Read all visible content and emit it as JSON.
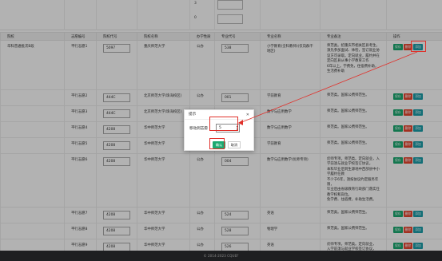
{
  "top_numbers": [
    "3",
    "0"
  ],
  "table": {
    "headers": [
      "院校",
      "志愿编号",
      "院校代号",
      "院校名称",
      "办学性质",
      "专业代号",
      "专业名称",
      "专业备注",
      "操作"
    ],
    "rows": [
      {
        "school": "华科普通批次B段",
        "vol": "平行志愿1",
        "code": "5097",
        "name": "重庆师范大学",
        "nature": "公办",
        "mcode": "538",
        "major": "小学教育(全科教师)(仅向群干地区)",
        "notes": [
          "师范类。招重庆市相关区县考生，须先参加面试、体检，签订就业协议方可录取。定向就业，履约并在定向区县从事小学教育工作",
          "6年以上。学费免，住宿费补助，生活费补助"
        ],
        "buttons": [
          "保存",
          "删除",
          "添加"
        ]
      },
      {
        "school": "",
        "vol": "平行志愿2",
        "code": "444C",
        "name": "北京师范大学(珠海校区)",
        "nature": "公办",
        "mcode": "001",
        "major": "学前教育",
        "notes": [
          "师范类。国家公费师范生。"
        ],
        "buttons": [
          "保存",
          "删除",
          "添加"
        ]
      },
      {
        "school": "",
        "vol": "平行志愿3",
        "code": "444C",
        "name": "北京师范大学(珠海校区)",
        "nature": "公办",
        "mcode": "002",
        "major": "数学与应用数学",
        "notes": [
          "师范类。国家公费师范生。"
        ],
        "buttons": [
          "保存",
          "删除",
          "添加"
        ]
      },
      {
        "school": "",
        "vol": "平行志愿4",
        "code": "4208",
        "name": "华中师范大学",
        "nature": "公办",
        "mcode": "003",
        "major": "数学与应用数学",
        "notes": [
          "师范类。国家公费师范生。"
        ],
        "buttons": [
          "保存",
          "删除",
          "添加"
        ]
      },
      {
        "school": "",
        "vol": "平行志愿5",
        "code": "4208",
        "name": "华中师范大学",
        "nature": "公办",
        "mcode": "006",
        "major": "学前教育",
        "notes": [
          "师范类。国家公费师范生。"
        ],
        "buttons": [
          "保存",
          "删除",
          "添加"
        ]
      },
      {
        "school": "",
        "vol": "平行志愿6",
        "code": "4208",
        "name": "华中师范大学",
        "nature": "公办",
        "mcode": "004",
        "major": "数学与应用数学(优师专项)",
        "notes": [
          "优师专项。师范类。定向就业，入学前须与就业学校签订协议，",
          "本科毕业后到生源地中西部县中小学履约任教",
          "不少于6年，须按协议约定服务年限，",
          "毕业后由省级教育行政部门落实任教学校和岗位。",
          "免学费、住宿费，补助生活费。"
        ],
        "buttons": [
          "保存",
          "删除",
          "添加"
        ]
      },
      {
        "school": "",
        "vol": "平行志愿7",
        "code": "4208",
        "name": "华中师范大学",
        "nature": "公办",
        "mcode": "524",
        "major": "英语",
        "notes": [
          "师范类。国家公费师范生。"
        ],
        "buttons": [
          "保存",
          "删除",
          "添加"
        ]
      },
      {
        "school": "",
        "vol": "平行志愿8",
        "code": "4208",
        "name": "华中师范大学",
        "nature": "公办",
        "mcode": "528",
        "major": "物理学",
        "notes": [
          "师范类。国家公费师范生。"
        ],
        "buttons": [
          "保存",
          "删除",
          "添加"
        ]
      },
      {
        "school": "",
        "vol": "平行志愿9",
        "code": "4208",
        "name": "华中师范大学",
        "nature": "公办",
        "mcode": "526",
        "major": "英语",
        "notes": [
          "优师专项。师范类。定向就业，",
          "入学前须与就业学校签订协议，",
          "本科毕业后到生源地中西部县中小学履约任教"
        ],
        "buttons": [
          "保存",
          "删除",
          "添加"
        ]
      }
    ]
  },
  "dialog": {
    "title": "提示",
    "label": "移动到志愿",
    "value": "5",
    "confirm": "确认",
    "cancel": "取消"
  },
  "footer": "© 2014-2023 CQUEF"
}
